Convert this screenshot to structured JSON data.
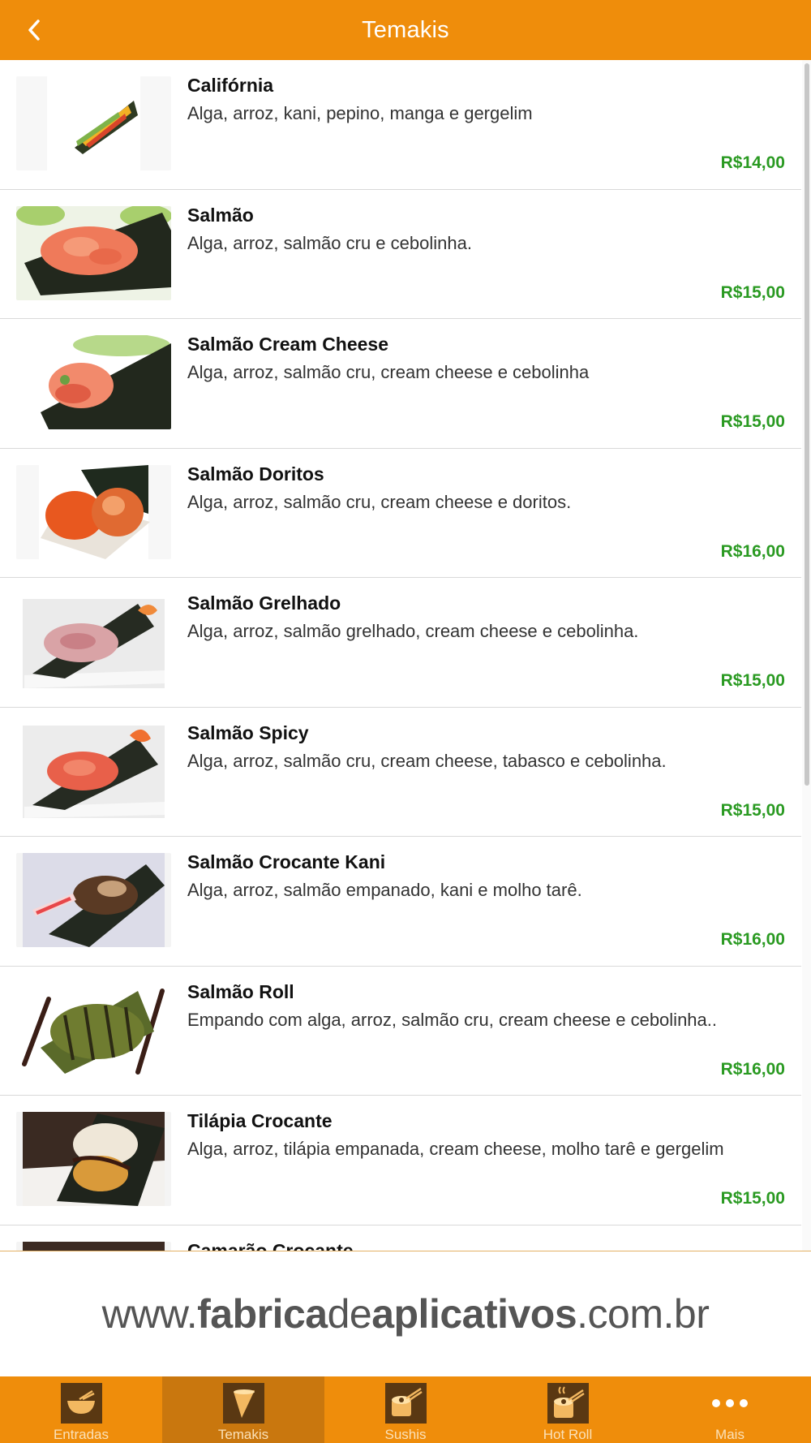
{
  "header": {
    "title": "Temakis",
    "back_icon": "chevron-left-icon"
  },
  "items": [
    {
      "name": "Califórnia",
      "description": "Alga, arroz, kani, pepino, manga e gergelim",
      "price": "R$14,00"
    },
    {
      "name": "Salmão",
      "description": "Alga, arroz, salmão cru e cebolinha.",
      "price": "R$15,00"
    },
    {
      "name": "Salmão Cream Cheese",
      "description": "Alga, arroz, salmão cru, cream cheese e cebolinha",
      "price": "R$15,00"
    },
    {
      "name": "Salmão Doritos",
      "description": "Alga, arroz, salmão cru, cream cheese e doritos.",
      "price": "R$16,00"
    },
    {
      "name": "Salmão Grelhado",
      "description": "Alga, arroz, salmão grelhado, cream cheese e cebolinha.",
      "price": "R$15,00"
    },
    {
      "name": "Salmão Spicy",
      "description": "Alga, arroz, salmão cru, cream cheese, tabasco e cebolinha.",
      "price": "R$15,00"
    },
    {
      "name": "Salmão Crocante Kani",
      "description": "Alga, arroz, salmão empanado, kani e molho tarê.",
      "price": "R$16,00"
    },
    {
      "name": "Salmão Roll",
      "description": "Empando com alga, arroz, salmão cru, cream cheese e cebolinha..",
      "price": "R$16,00"
    },
    {
      "name": "Tilápia Crocante",
      "description": "Alga, arroz, tilápia empanada, cream cheese, molho tarê e gergelim",
      "price": "R$15,00"
    },
    {
      "name": "Camarão Crocante",
      "description": "",
      "price": ""
    }
  ],
  "banner": {
    "prefix": "www.",
    "part1": "fabrica",
    "part2": "de",
    "part3": "aplicativos",
    "suffix": ".com.br"
  },
  "tabs": [
    {
      "label": "Entradas",
      "icon": "bowl-icon",
      "active": false
    },
    {
      "label": "Temakis",
      "icon": "temaki-cone-icon",
      "active": true
    },
    {
      "label": "Sushis",
      "icon": "sushi-roll-icon",
      "active": false
    },
    {
      "label": "Hot Roll",
      "icon": "hot-roll-icon",
      "active": false
    },
    {
      "label": "Mais",
      "icon": "more-dots-icon",
      "active": false
    }
  ],
  "colors": {
    "accent": "#ef8d0b",
    "active_tab": "#c9770e",
    "price": "#2a9a22"
  }
}
